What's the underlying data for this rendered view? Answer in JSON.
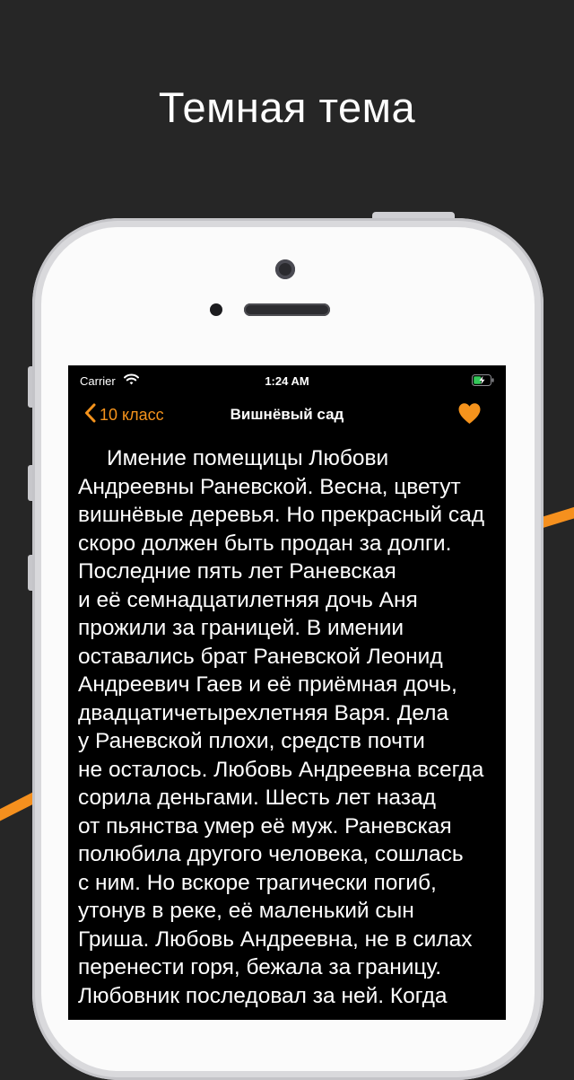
{
  "promo": {
    "title": "Темная тема"
  },
  "colors": {
    "accent": "#f5931c",
    "background": "#262626",
    "screen": "#000000"
  },
  "status_bar": {
    "carrier": "Carrier",
    "time": "1:24 AM",
    "icons": [
      "wifi-icon",
      "battery-charging-icon"
    ]
  },
  "nav": {
    "back_label": "10 класс",
    "title": "Вишнёвый сад",
    "back_icon": "chevron-left-icon",
    "favorite_icon": "heart-icon"
  },
  "content": {
    "lines": [
      "Имение помещицы Любови",
      "Андреевны Раневской. Весна, цветут",
      "вишнёвые деревья. Но прекрасный сад",
      "скоро должен быть продан за долги.",
      "Последние пять лет Раневская",
      "и её семнадцатилетняя дочь Аня",
      "прожили за границей. В имении",
      "оставались брат Раневской Леонид",
      "Андреевич Гаев и её приёмная дочь,",
      "двадцатичетырехлетняя Варя. Дела",
      "у Раневской плохи, средств почти",
      "не осталось. Любовь Андреевна всегда",
      "сорила деньгами. Шесть лет назад",
      "от пьянства умер её муж. Раневская",
      "полюбила другого человека, сошлась",
      "с ним. Но вскоре трагически погиб,",
      "утонув в реке, её маленький сын",
      "Гриша. Любовь Андреевна, не в силах",
      "перенести горя, бежала за границу.",
      "Любовник последовал за ней. Когда"
    ]
  }
}
